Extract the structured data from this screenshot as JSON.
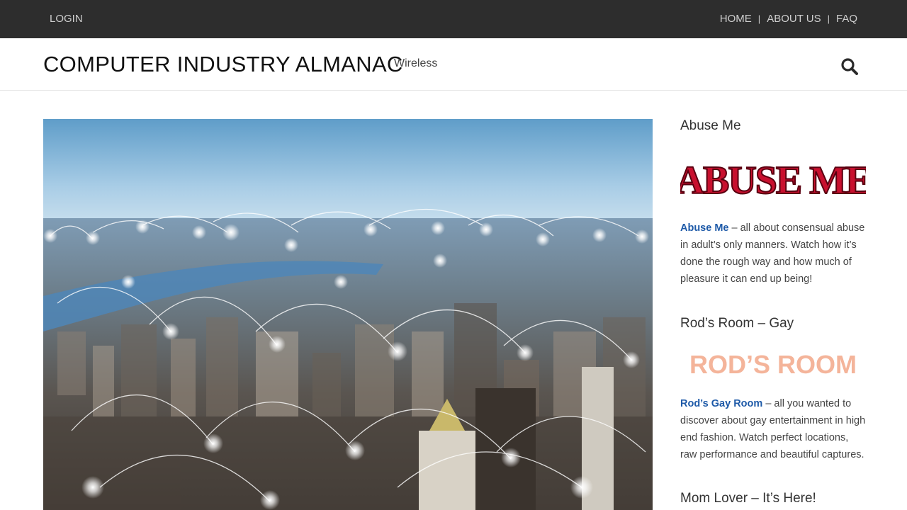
{
  "topbar": {
    "login": "LOGIN",
    "nav": [
      "HOME",
      "ABOUT US",
      "FAQ"
    ],
    "separator": "|"
  },
  "header": {
    "site_title": "COMPUTER INDUSTRY ALMANAC",
    "tagline": "Wireless",
    "search_icon": "search-icon"
  },
  "sidebar": {
    "widgets": [
      {
        "title": "Abuse Me",
        "logo_text": "ABUSE ME",
        "link_text": "Abuse Me",
        "body": " – all about consensual abuse in adult’s only manners. Watch how it’s done the rough way and how much of pleasure it can end up being!"
      },
      {
        "title": "Rod’s Room – Gay",
        "logo_text": "ROD’S ROOM",
        "link_text": "Rod’s Gay Room",
        "body": " – all you wanted to discover about gay entertainment in high end fashion. Watch perfect locations, raw performance and beautiful captures."
      },
      {
        "title": "Mom Lover – It’s Here!"
      }
    ]
  },
  "colors": {
    "topbar_bg": "#2d2d2d",
    "link": "#1e5aa8",
    "abuse_logo": "#c8102e",
    "rods_logo": "#f4b49a"
  }
}
